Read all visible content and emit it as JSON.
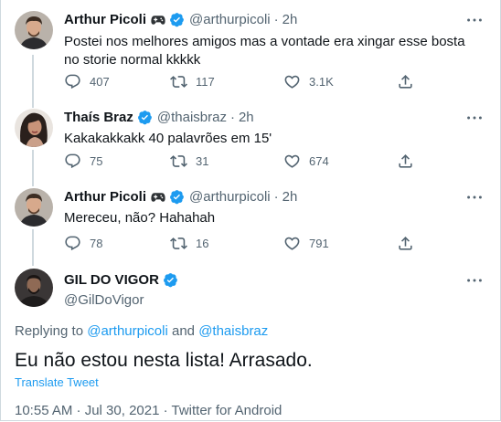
{
  "thread": [
    {
      "name": "Arthur Picoli",
      "emoji": "gamepad",
      "verified": true,
      "handle": "@arthurpicoli",
      "separator": "·",
      "time": "2h",
      "text": "Postei nos melhores amigos mas a vontade era xingar esse bosta no storie normal kkkkk",
      "replies": "407",
      "retweets": "117",
      "likes": "3.1K"
    },
    {
      "name": "Thaís Braz",
      "verified": true,
      "handle": "@thaisbraz",
      "separator": "·",
      "time": "2h",
      "text": "Kakakakkakk 40 palavrões em 15'",
      "replies": "75",
      "retweets": "31",
      "likes": "674"
    },
    {
      "name": "Arthur Picoli",
      "emoji": "gamepad",
      "verified": true,
      "handle": "@arthurpicoli",
      "separator": "·",
      "time": "2h",
      "text": "Mereceu, não? Hahahah",
      "replies": "78",
      "retweets": "16",
      "likes": "791"
    }
  ],
  "main": {
    "name": "GIL DO VIGOR",
    "verified": true,
    "handle": "@GilDoVigor",
    "replying_prefix": "Replying to ",
    "replying_user1": "@arthurpicoli",
    "replying_and": " and ",
    "replying_user2": "@thaisbraz",
    "text": "Eu não estou nesta lista! Arrasado.",
    "translate": "Translate Tweet",
    "meta": "10:55 AM · Jul 30, 2021 · Twitter for Android"
  },
  "colors": {
    "accent": "#1d9bf0",
    "secondary_text": "#536471",
    "verified": "#1d9bf0"
  },
  "icons": [
    "reply-icon",
    "retweet-icon",
    "like-icon",
    "share-icon",
    "more-icon",
    "verified-badge-icon",
    "gamepad-icon"
  ]
}
